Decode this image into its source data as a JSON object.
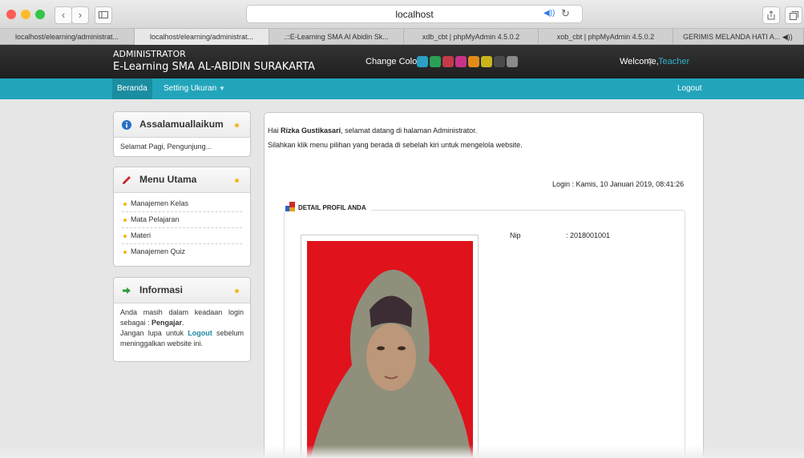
{
  "browser": {
    "url": "localhost",
    "tabs": [
      {
        "label": "localhost/elearning/administrat...",
        "active": false
      },
      {
        "label": "localhost/elearning/administrat...",
        "active": true
      },
      {
        "label": ".::E-Learning SMA Al Abidin Sk...",
        "active": false
      },
      {
        "label": "xdb_cbt | phpMyAdmin 4.5.0.2",
        "active": false
      },
      {
        "label": "xob_cbt | phpMyAdmin 4.5.0.2",
        "active": false
      },
      {
        "label": "GERIMIS MELANDA HATI A...",
        "active": false
      }
    ]
  },
  "header": {
    "role": "ADMINISTRATOR",
    "site_title": "E-Learning SMA AL-ABIDIN SURAKARTA",
    "change_color_label": "Change Color",
    "swatches": [
      "#2b9fc4",
      "#2aa055",
      "#c43a4a",
      "#c8338a",
      "#e08a1a",
      "#c9b51b",
      "#4a4a4a",
      "#8a8a8a"
    ],
    "welcome_label": "Welcome,",
    "user_name": "Teacher"
  },
  "nav": {
    "home": "Beranda",
    "settings": "Setting Ukuran",
    "logout": "Logout"
  },
  "sidebar": {
    "greeting": {
      "title": "Assalamuallaikum",
      "text": "Selamat Pagi, Pengunjung..."
    },
    "menu": {
      "title": "Menu Utama",
      "items": [
        "Manajemen Kelas",
        "Mata Pelajaran",
        "Materi",
        "Manajemen Quiz"
      ]
    },
    "info": {
      "title": "Informasi",
      "line1": "Anda masih dalam keadaan login sebagai :",
      "role": "Pengajar",
      "line2a": "Jangan lupa untuk",
      "logout_link": "Logout",
      "line2b": "sebelum meninggalkan website ini."
    }
  },
  "main": {
    "greeting_prefix": "Hai",
    "user_fullname": "Rizka Gustikasari",
    "greeting_suffix": ", selamat datang di halaman Administrator.",
    "instruction": "Silahkan klik menu pilihan yang berada di sebelah kiri untuk mengelola website.",
    "login_info": "Login : Kamis, 10 Januari 2019, 08:41:26",
    "profile_legend": "DETAIL PROFIL ANDA",
    "nip_label": "Nip",
    "nip_value": ": 2018001001"
  }
}
